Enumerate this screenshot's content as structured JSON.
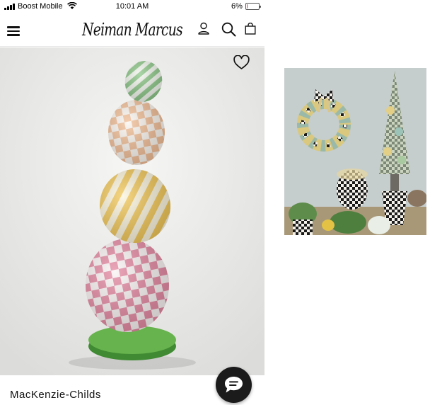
{
  "status_bar": {
    "carrier": "Boost Mobile",
    "time": "10:01 AM",
    "battery": "6%",
    "battery_level": 0.06,
    "battery_color": "#e53935"
  },
  "header": {
    "logo": "Neiman Marcus",
    "icons": [
      "menu-icon",
      "account-icon",
      "search-icon",
      "bag-icon"
    ]
  },
  "product": {
    "brand": "MacKenzie-Childs",
    "favorite_icon": "heart-outline-icon"
  },
  "chat": {
    "icon": "chat-bubble-icon",
    "color": "#1b1b1b"
  }
}
